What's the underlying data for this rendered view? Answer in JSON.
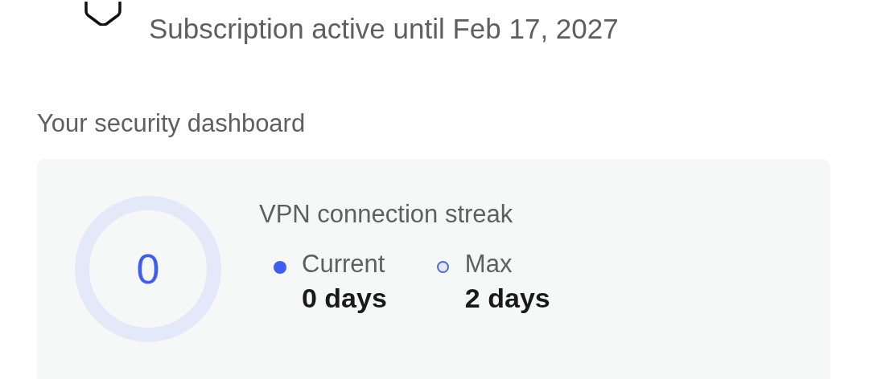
{
  "account": {
    "subscription": "Subscription active until Feb 17, 2027"
  },
  "dashboard": {
    "heading": "Your security dashboard",
    "streak": {
      "ring_value": "0",
      "title": "VPN connection streak",
      "items": [
        {
          "kind": "filled",
          "label": "Current",
          "value": "0 days"
        },
        {
          "kind": "outline",
          "label": "Max",
          "value": "2 days"
        }
      ]
    }
  }
}
